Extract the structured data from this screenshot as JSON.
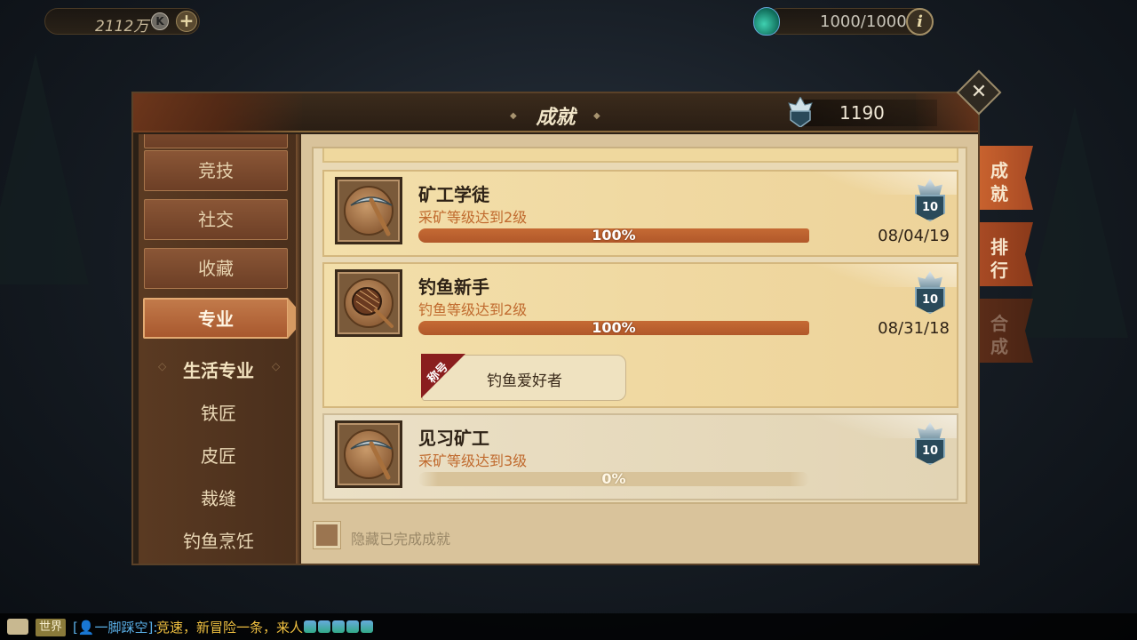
{
  "hud": {
    "gold": "2112万",
    "gold_currency_icon": "k-coin-icon",
    "energy": "1000/1000"
  },
  "panel": {
    "title": "成就",
    "points": "1190"
  },
  "sidebar": {
    "categories": [
      {
        "label": "竞技"
      },
      {
        "label": "社交"
      },
      {
        "label": "收藏"
      },
      {
        "label": "专业",
        "active": true
      }
    ],
    "sub_header": "生活专业",
    "sub_items": [
      {
        "label": "铁匠"
      },
      {
        "label": "皮匠"
      },
      {
        "label": "裁缝"
      },
      {
        "label": "钓鱼烹饪"
      }
    ]
  },
  "achievements": [
    {
      "name": "矿工学徒",
      "desc": "采矿等级达到2级",
      "progress_text": "100%",
      "progress": 1.0,
      "points": "10",
      "date": "08/04/19",
      "icon": "pickaxe-icon"
    },
    {
      "name": "钓鱼新手",
      "desc": "钓鱼等级达到2级",
      "progress_text": "100%",
      "progress": 1.0,
      "points": "10",
      "date": "08/31/18",
      "icon": "fishing-net-icon",
      "reward": {
        "tag": "称号",
        "title": "钓鱼爱好者"
      }
    },
    {
      "name": "见习矿工",
      "desc": "采矿等级达到3级",
      "progress_text": "0%",
      "progress": 0.0,
      "points": "10",
      "date": "",
      "icon": "pickaxe-icon"
    }
  ],
  "hide_completed_label": "隐藏已完成成就",
  "right_tabs": [
    {
      "l1": "成",
      "l2": "就",
      "state": "active"
    },
    {
      "l1": "排",
      "l2": "行",
      "state": "normal"
    },
    {
      "l1": "合",
      "l2": "成",
      "state": "inactive"
    }
  ],
  "chat": {
    "channel": "世界",
    "user": "[👤一脚踩空]:",
    "message": "竞速，新冒险一条，来人"
  },
  "colors": {
    "accent": "#c06a2e",
    "progress_fill": "#b1582a",
    "tab_active": "#c8622e",
    "chat_text": "#f0c040"
  }
}
